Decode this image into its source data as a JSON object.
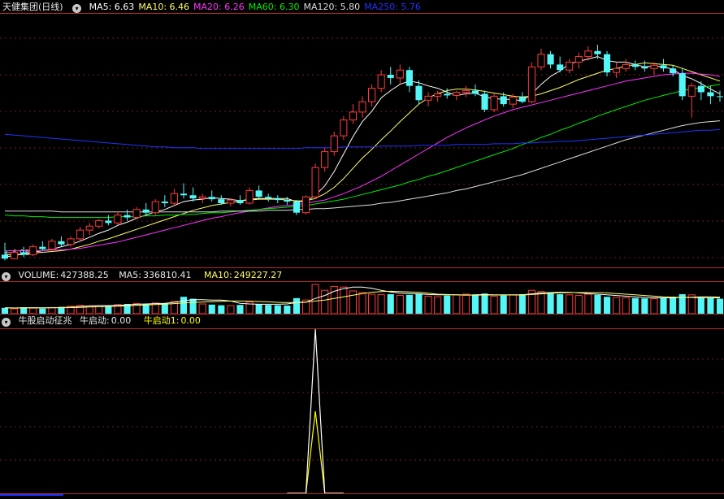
{
  "colors": {
    "background": "#000000",
    "panel_border": "#b32a2a",
    "grid": "#6b1f1f",
    "up": "#ff3b3b",
    "down": "#54f7f7",
    "ma5": "#ffffff",
    "ma10": "#ffff66",
    "ma20": "#ff33ff",
    "ma60": "#00ee00",
    "ma120": "#dddddd",
    "ma250": "#2233ff",
    "signal_a": "#ffffff",
    "signal_b": "#ffff00"
  },
  "price_panel": {
    "title": "天健集团(日线)",
    "ma_labels": [
      {
        "label": "MA5:",
        "value": "6.63",
        "color": "#ffffff"
      },
      {
        "label": "MA10:",
        "value": "6.46",
        "color": "#ffff66"
      },
      {
        "label": "MA20:",
        "value": "6.26",
        "color": "#ff33ff"
      },
      {
        "label": "MA60:",
        "value": "6.30",
        "color": "#00ee00"
      },
      {
        "label": "MA120:",
        "value": "5.80",
        "color": "#dddddd"
      },
      {
        "label": "MA250:",
        "value": "5.76",
        "color": "#2233ff"
      }
    ],
    "low_marker": "4.98"
  },
  "volume_panel": {
    "title": "VOLUME:",
    "value": "427388.25",
    "ma5_label": "MA5:",
    "ma5_value": "336810.41",
    "ma10_label": "MA10:",
    "ma10_value": "249227.27"
  },
  "indicator_panel": {
    "title": "牛股启动征兆",
    "series_a_label": "牛启动:",
    "series_a_value": "0.00",
    "series_b_label": "牛启动1:",
    "series_b_value": "0.00"
  },
  "chart_data": {
    "type": "candlestick",
    "price_range": [
      4.9,
      8.1
    ],
    "ohlc": [
      [
        5.05,
        5.2,
        4.98,
        5.0
      ],
      [
        5.0,
        5.12,
        4.99,
        5.08
      ],
      [
        5.08,
        5.15,
        5.02,
        5.05
      ],
      [
        5.05,
        5.18,
        5.03,
        5.15
      ],
      [
        5.15,
        5.22,
        5.1,
        5.12
      ],
      [
        5.12,
        5.25,
        5.1,
        5.22
      ],
      [
        5.22,
        5.28,
        5.15,
        5.18
      ],
      [
        5.18,
        5.28,
        5.15,
        5.25
      ],
      [
        5.25,
        5.4,
        5.22,
        5.36
      ],
      [
        5.36,
        5.45,
        5.3,
        5.41
      ],
      [
        5.41,
        5.5,
        5.38,
        5.48
      ],
      [
        5.48,
        5.55,
        5.42,
        5.45
      ],
      [
        5.45,
        5.6,
        5.42,
        5.55
      ],
      [
        5.55,
        5.62,
        5.48,
        5.52
      ],
      [
        5.52,
        5.65,
        5.5,
        5.62
      ],
      [
        5.62,
        5.7,
        5.55,
        5.58
      ],
      [
        5.58,
        5.75,
        5.55,
        5.72
      ],
      [
        5.72,
        5.8,
        5.65,
        5.7
      ],
      [
        5.7,
        5.88,
        5.66,
        5.82
      ],
      [
        5.82,
        5.95,
        5.76,
        5.8
      ],
      [
        5.8,
        5.9,
        5.72,
        5.76
      ],
      [
        5.76,
        5.82,
        5.7,
        5.78
      ],
      [
        5.78,
        5.86,
        5.72,
        5.75
      ],
      [
        5.75,
        5.8,
        5.68,
        5.7
      ],
      [
        5.7,
        5.76,
        5.66,
        5.74
      ],
      [
        5.74,
        5.8,
        5.68,
        5.7
      ],
      [
        5.7,
        5.9,
        5.68,
        5.86
      ],
      [
        5.86,
        5.92,
        5.76,
        5.78
      ],
      [
        5.78,
        5.82,
        5.72,
        5.76
      ],
      [
        5.76,
        5.8,
        5.7,
        5.74
      ],
      [
        5.74,
        5.78,
        5.68,
        5.72
      ],
      [
        5.72,
        5.74,
        5.55,
        5.58
      ],
      [
        5.58,
        5.8,
        5.56,
        5.78
      ],
      [
        5.78,
        6.2,
        5.76,
        6.15
      ],
      [
        6.15,
        6.4,
        6.1,
        6.35
      ],
      [
        6.35,
        6.6,
        6.3,
        6.55
      ],
      [
        6.55,
        6.8,
        6.5,
        6.75
      ],
      [
        6.75,
        6.95,
        6.7,
        6.85
      ],
      [
        6.85,
        7.05,
        6.78,
        6.98
      ],
      [
        6.98,
        7.2,
        6.92,
        7.15
      ],
      [
        7.15,
        7.38,
        7.1,
        7.32
      ],
      [
        7.32,
        7.42,
        7.2,
        7.28
      ],
      [
        7.28,
        7.45,
        7.2,
        7.38
      ],
      [
        7.38,
        7.42,
        7.1,
        7.18
      ],
      [
        7.18,
        7.25,
        6.95,
        7.0
      ],
      [
        7.0,
        7.1,
        6.92,
        7.05
      ],
      [
        7.05,
        7.12,
        6.98,
        7.08
      ],
      [
        7.08,
        7.15,
        7.02,
        7.06
      ],
      [
        7.06,
        7.12,
        7.0,
        7.1
      ],
      [
        7.1,
        7.18,
        7.04,
        7.12
      ],
      [
        7.12,
        7.2,
        7.05,
        7.08
      ],
      [
        7.08,
        7.12,
        6.85,
        6.88
      ],
      [
        6.88,
        7.08,
        6.85,
        7.05
      ],
      [
        7.05,
        7.1,
        6.92,
        6.95
      ],
      [
        6.95,
        7.08,
        6.9,
        7.04
      ],
      [
        7.04,
        7.1,
        6.96,
        6.98
      ],
      [
        6.98,
        7.48,
        6.96,
        7.42
      ],
      [
        7.42,
        7.65,
        7.38,
        7.58
      ],
      [
        7.58,
        7.62,
        7.4,
        7.45
      ],
      [
        7.45,
        7.55,
        7.35,
        7.38
      ],
      [
        7.38,
        7.52,
        7.34,
        7.48
      ],
      [
        7.48,
        7.6,
        7.4,
        7.55
      ],
      [
        7.55,
        7.68,
        7.5,
        7.62
      ],
      [
        7.62,
        7.7,
        7.52,
        7.58
      ],
      [
        7.58,
        7.62,
        7.3,
        7.35
      ],
      [
        7.35,
        7.48,
        7.28,
        7.4
      ],
      [
        7.4,
        7.52,
        7.36,
        7.45
      ],
      [
        7.45,
        7.5,
        7.38,
        7.42
      ],
      [
        7.42,
        7.5,
        7.36,
        7.4
      ],
      [
        7.4,
        7.48,
        7.32,
        7.44
      ],
      [
        7.44,
        7.52,
        7.36,
        7.4
      ],
      [
        7.4,
        7.44,
        7.3,
        7.34
      ],
      [
        7.34,
        7.4,
        7.0,
        7.05
      ],
      [
        7.05,
        7.22,
        6.78,
        7.18
      ],
      [
        7.18,
        7.24,
        7.0,
        7.1
      ],
      [
        7.1,
        7.18,
        6.95,
        7.05
      ],
      [
        7.05,
        7.12,
        6.98,
        7.04
      ]
    ],
    "ma": {
      "MA5": [
        5.02,
        5.04,
        5.06,
        5.08,
        5.1,
        5.12,
        5.15,
        5.18,
        5.22,
        5.27,
        5.32,
        5.36,
        5.42,
        5.46,
        5.51,
        5.55,
        5.59,
        5.62,
        5.67,
        5.72,
        5.74,
        5.75,
        5.77,
        5.76,
        5.75,
        5.73,
        5.75,
        5.76,
        5.76,
        5.76,
        5.76,
        5.72,
        5.72,
        5.8,
        5.92,
        6.1,
        6.32,
        6.54,
        6.73,
        6.86,
        7.03,
        7.12,
        7.2,
        7.24,
        7.22,
        7.18,
        7.15,
        7.1,
        7.06,
        7.08,
        7.09,
        7.04,
        7.02,
        7.01,
        7.01,
        6.99,
        7.08,
        7.2,
        7.3,
        7.37,
        7.46,
        7.49,
        7.52,
        7.55,
        7.5,
        7.48,
        7.48,
        7.45,
        7.42,
        7.43,
        7.42,
        7.39,
        7.31,
        7.27,
        7.21,
        7.14,
        7.08
      ],
      "MA10": [
        5.05,
        5.05,
        5.06,
        5.07,
        5.08,
        5.09,
        5.1,
        5.12,
        5.15,
        5.18,
        5.22,
        5.25,
        5.29,
        5.33,
        5.37,
        5.41,
        5.45,
        5.49,
        5.53,
        5.57,
        5.61,
        5.64,
        5.67,
        5.69,
        5.71,
        5.73,
        5.74,
        5.75,
        5.75,
        5.75,
        5.74,
        5.73,
        5.73,
        5.76,
        5.82,
        5.9,
        6.01,
        6.14,
        6.27,
        6.38,
        6.5,
        6.61,
        6.73,
        6.84,
        6.95,
        7.03,
        7.08,
        7.12,
        7.14,
        7.14,
        7.13,
        7.11,
        7.09,
        7.07,
        7.05,
        7.04,
        7.05,
        7.08,
        7.12,
        7.16,
        7.21,
        7.26,
        7.3,
        7.34,
        7.38,
        7.4,
        7.43,
        7.45,
        7.47,
        7.46,
        7.45,
        7.44,
        7.4,
        7.36,
        7.32,
        7.28,
        7.24
      ],
      "MA20": [
        5.1,
        5.1,
        5.1,
        5.1,
        5.1,
        5.11,
        5.11,
        5.12,
        5.13,
        5.15,
        5.17,
        5.19,
        5.21,
        5.24,
        5.27,
        5.3,
        5.33,
        5.36,
        5.39,
        5.42,
        5.45,
        5.48,
        5.51,
        5.53,
        5.56,
        5.58,
        5.6,
        5.62,
        5.64,
        5.66,
        5.67,
        5.68,
        5.7,
        5.72,
        5.74,
        5.78,
        5.82,
        5.87,
        5.92,
        5.98,
        6.04,
        6.11,
        6.18,
        6.25,
        6.32,
        6.39,
        6.46,
        6.53,
        6.59,
        6.65,
        6.7,
        6.75,
        6.8,
        6.84,
        6.88,
        6.91,
        6.94,
        6.97,
        7.0,
        7.03,
        7.06,
        7.09,
        7.12,
        7.15,
        7.18,
        7.21,
        7.24,
        7.26,
        7.28,
        7.3,
        7.32,
        7.33,
        7.34,
        7.34,
        7.33,
        7.32,
        7.3
      ],
      "MA60": [
        5.55,
        5.54,
        5.54,
        5.53,
        5.53,
        5.52,
        5.52,
        5.52,
        5.52,
        5.52,
        5.52,
        5.52,
        5.53,
        5.53,
        5.53,
        5.54,
        5.54,
        5.55,
        5.55,
        5.56,
        5.56,
        5.57,
        5.58,
        5.58,
        5.59,
        5.6,
        5.61,
        5.62,
        5.63,
        5.64,
        5.65,
        5.66,
        5.67,
        5.69,
        5.71,
        5.73,
        5.75,
        5.78,
        5.81,
        5.84,
        5.87,
        5.9,
        5.93,
        5.97,
        6.0,
        6.04,
        6.07,
        6.11,
        6.15,
        6.19,
        6.23,
        6.27,
        6.31,
        6.35,
        6.39,
        6.44,
        6.48,
        6.53,
        6.57,
        6.62,
        6.66,
        6.71,
        6.75,
        6.8,
        6.84,
        6.88,
        6.92,
        6.96,
        7.0,
        7.03,
        7.06,
        7.09,
        7.12,
        7.14,
        7.16,
        7.18,
        7.2
      ],
      "MA120": [
        5.6,
        5.6,
        5.6,
        5.6,
        5.6,
        5.6,
        5.59,
        5.59,
        5.59,
        5.59,
        5.59,
        5.59,
        5.59,
        5.59,
        5.59,
        5.59,
        5.59,
        5.59,
        5.59,
        5.59,
        5.59,
        5.59,
        5.59,
        5.6,
        5.6,
        5.6,
        5.6,
        5.6,
        5.61,
        5.61,
        5.61,
        5.62,
        5.62,
        5.63,
        5.63,
        5.64,
        5.65,
        5.66,
        5.67,
        5.68,
        5.7,
        5.71,
        5.73,
        5.75,
        5.77,
        5.79,
        5.81,
        5.83,
        5.86,
        5.88,
        5.91,
        5.94,
        5.97,
        6.0,
        6.03,
        6.06,
        6.1,
        6.14,
        6.18,
        6.22,
        6.26,
        6.3,
        6.34,
        6.38,
        6.42,
        6.46,
        6.5,
        6.53,
        6.56,
        6.59,
        6.62,
        6.65,
        6.68,
        6.7,
        6.72,
        6.73,
        6.74
      ],
      "MA250": [
        6.57,
        6.56,
        6.55,
        6.54,
        6.53,
        6.52,
        6.51,
        6.5,
        6.49,
        6.48,
        6.47,
        6.46,
        6.45,
        6.44,
        6.43,
        6.42,
        6.41,
        6.41,
        6.4,
        6.4,
        6.4,
        6.39,
        6.39,
        6.39,
        6.39,
        6.39,
        6.39,
        6.39,
        6.39,
        6.39,
        6.39,
        6.39,
        6.4,
        6.4,
        6.4,
        6.4,
        6.41,
        6.41,
        6.41,
        6.41,
        6.42,
        6.42,
        6.42,
        6.42,
        6.43,
        6.43,
        6.43,
        6.43,
        6.44,
        6.44,
        6.44,
        6.44,
        6.45,
        6.45,
        6.45,
        6.46,
        6.46,
        6.47,
        6.47,
        6.48,
        6.48,
        6.49,
        6.5,
        6.51,
        6.52,
        6.53,
        6.54,
        6.55,
        6.56,
        6.57,
        6.58,
        6.59,
        6.6,
        6.61,
        6.62,
        6.62,
        6.63
      ]
    },
    "volume": [
      180,
      150,
      200,
      170,
      160,
      190,
      210,
      230,
      260,
      240,
      250,
      230,
      280,
      300,
      310,
      290,
      330,
      320,
      380,
      520,
      460,
      300,
      280,
      260,
      250,
      270,
      360,
      300,
      270,
      260,
      250,
      480,
      420,
      900,
      720,
      840,
      820,
      700,
      650,
      600,
      590,
      600,
      560,
      580,
      620,
      540,
      520,
      560,
      580,
      600,
      590,
      620,
      540,
      560,
      580,
      600,
      720,
      680,
      640,
      600,
      580,
      560,
      600,
      580,
      520,
      500,
      490,
      480,
      470,
      460,
      480,
      520,
      600,
      580,
      500,
      480,
      460
    ],
    "volume_ma5": [
      180,
      175,
      180,
      185,
      180,
      185,
      190,
      200,
      220,
      240,
      250,
      250,
      255,
      270,
      290,
      300,
      310,
      320,
      350,
      400,
      430,
      430,
      420,
      420,
      390,
      320,
      300,
      290,
      290,
      290,
      300,
      340,
      350,
      470,
      560,
      690,
      770,
      820,
      820,
      780,
      720,
      670,
      630,
      620,
      610,
      590,
      580,
      580,
      580,
      570,
      580,
      590,
      580,
      580,
      580,
      580,
      610,
      640,
      650,
      660,
      660,
      640,
      620,
      600,
      580,
      560,
      540,
      520,
      500,
      490,
      490,
      490,
      500,
      510,
      520,
      520,
      510
    ],
    "volume_ma10": [
      180,
      178,
      180,
      181,
      180,
      182,
      184,
      188,
      195,
      205,
      215,
      222,
      232,
      245,
      258,
      270,
      282,
      294,
      310,
      330,
      348,
      360,
      370,
      380,
      390,
      390,
      385,
      375,
      365,
      350,
      340,
      350,
      360,
      390,
      420,
      470,
      520,
      570,
      620,
      660,
      680,
      690,
      680,
      670,
      660,
      630,
      600,
      590,
      580,
      575,
      570,
      575,
      575,
      575,
      575,
      575,
      590,
      610,
      630,
      640,
      650,
      650,
      650,
      650,
      640,
      620,
      600,
      580,
      560,
      540,
      520,
      510,
      500,
      500,
      495,
      490,
      485
    ],
    "signal_series_a": {
      "values": [
        0,
        0,
        0,
        1,
        0,
        0,
        0
      ],
      "center_index": 33
    },
    "signal_series_b": {
      "values": [
        0,
        0,
        0,
        0.5,
        0,
        0,
        0
      ],
      "center_index": 33
    }
  }
}
